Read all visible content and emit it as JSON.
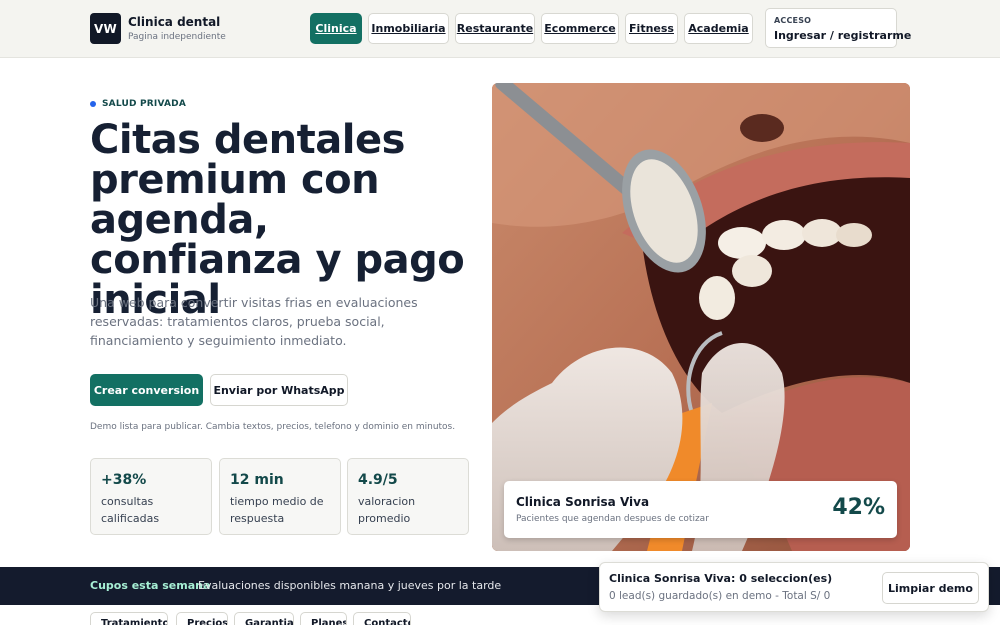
{
  "brand": {
    "logo_text": "VW",
    "title": "Clinica dental",
    "subtitle": "Pagina independiente"
  },
  "nav": {
    "items": [
      {
        "label": "Clinica",
        "active": true
      },
      {
        "label": "Inmobiliaria",
        "active": false
      },
      {
        "label": "Restaurante",
        "active": false
      },
      {
        "label": "Ecommerce",
        "active": false
      },
      {
        "label": "Fitness",
        "active": false
      },
      {
        "label": "Academia",
        "active": false
      }
    ],
    "access": {
      "label": "ACCESO",
      "link": "Ingresar / registrarme"
    }
  },
  "hero": {
    "eyebrow": "SALUD PRIVADA",
    "title": "Citas dentales premium con agenda, confianza y pago inicial",
    "description": "Una web para convertir visitas frias en evaluaciones reservadas: tratamientos claros, prueba social, financiamiento y seguimiento inmediato.",
    "primary_button": "Crear conversion",
    "secondary_button": "Enviar por WhatsApp",
    "note": "Demo lista para publicar. Cambia textos, precios, telefono y dominio en minutos.",
    "stats": [
      {
        "value": "+38%",
        "label": "consultas calificadas"
      },
      {
        "value": "12 min",
        "label": "tiempo medio de respuesta"
      },
      {
        "value": "4.9/5",
        "label": "valoracion promedio"
      }
    ]
  },
  "image_card": {
    "name": "Clinica Sonrisa Viva",
    "subtitle": "Pacientes que agendan despues de cotizar",
    "percent": "42%"
  },
  "cupos": {
    "title": "Cupos esta semana",
    "text": "Evaluaciones disponibles manana y jueves por la tarde"
  },
  "toast": {
    "title": "Clinica Sonrisa Viva: 0 seleccion(es)",
    "subtitle": "0 lead(s) guardado(s) en demo - Total S/ 0",
    "button": "Limpiar demo"
  },
  "sub_tabs": [
    "Tratamientos",
    "Precios",
    "Garantias",
    "Planes",
    "Contacto"
  ],
  "colors": {
    "accent": "#137063",
    "dark": "#162033",
    "bar": "#141b2d",
    "eyebrow_dot": "#2563eb"
  }
}
